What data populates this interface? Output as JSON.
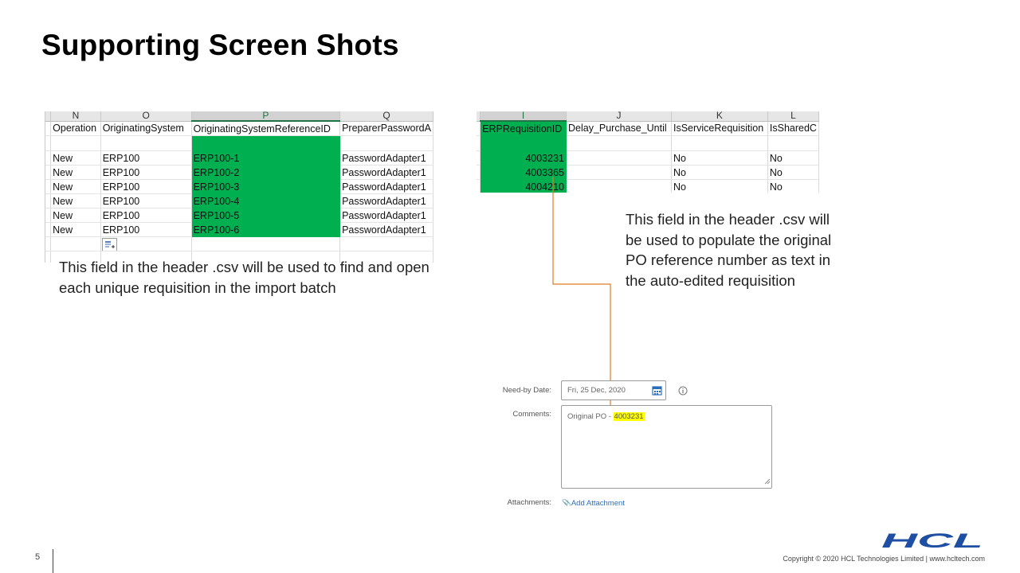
{
  "title": "Supporting Screen Shots",
  "sheet1": {
    "col_letters": [
      "N",
      "O",
      "P",
      "Q"
    ],
    "headers": [
      "Operation",
      "OriginatingSystem",
      "OriginatingSystemReferenceID",
      "PreparerPasswordA"
    ],
    "rows": [
      [
        "New",
        "ERP100",
        "ERP100-1",
        "PasswordAdapter1"
      ],
      [
        "New",
        "ERP100",
        "ERP100-2",
        "PasswordAdapter1"
      ],
      [
        "New",
        "ERP100",
        "ERP100-3",
        "PasswordAdapter1"
      ],
      [
        "New",
        "ERP100",
        "ERP100-4",
        "PasswordAdapter1"
      ],
      [
        "New",
        "ERP100",
        "ERP100-5",
        "PasswordAdapter1"
      ],
      [
        "New",
        "ERP100",
        "ERP100-6",
        "PasswordAdapter1"
      ]
    ],
    "highlight_color": "#00b050"
  },
  "caption1": "This field in the header .csv will be used to find and open each unique requisition in the import batch",
  "sheet2": {
    "col_letters": [
      "I",
      "J",
      "K",
      "L"
    ],
    "headers": [
      "ERPRequisitionID",
      "Delay_Purchase_Until",
      "IsServiceRequisition",
      "IsSharedC"
    ],
    "rows": [
      [
        "4003231",
        "",
        "No",
        "No"
      ],
      [
        "4003365",
        "",
        "No",
        "No"
      ],
      [
        "4004210",
        "",
        "No",
        "No"
      ]
    ]
  },
  "caption2": "This field in the header .csv will be used to populate the original PO reference number as text in the auto-edited requisition",
  "form": {
    "need_by_label": "Need-by Date:",
    "need_by_value": "Fri, 25 Dec, 2020",
    "comments_label": "Comments:",
    "comments_prefix": "Original PO - ",
    "comments_po": "4003231",
    "attachments_label": "Attachments:",
    "add_attachment": "Add Attachment"
  },
  "arrow_color": "#e07b20",
  "footer": {
    "page_number": "5",
    "copyright": "Copyright © 2020 HCL Technologies Limited | www.hcltech.com",
    "logo_text": "HCL",
    "logo_color": "#1f4fa3"
  }
}
